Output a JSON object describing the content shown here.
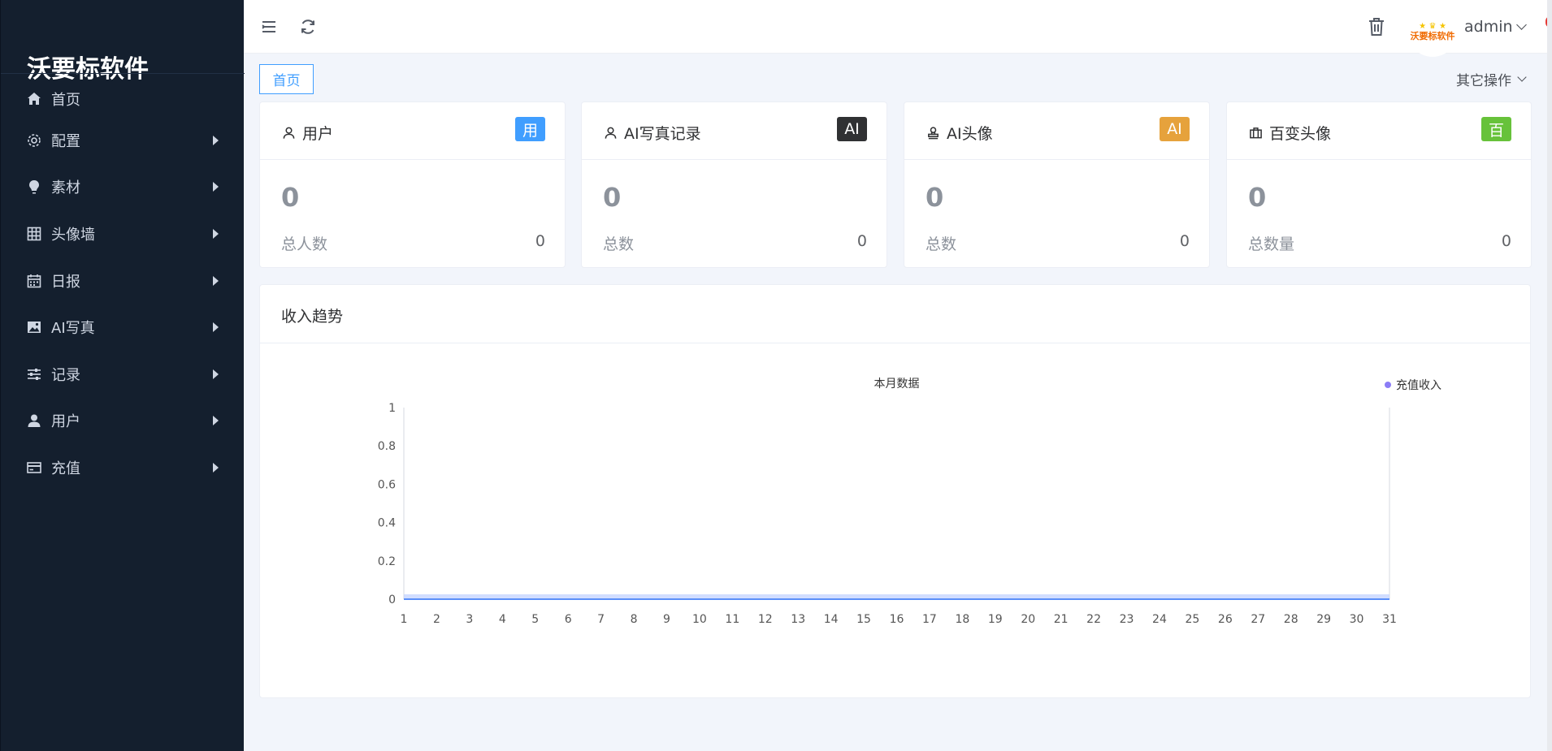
{
  "sidebar": {
    "brand": "沃要标软件",
    "items": [
      {
        "label": "首页",
        "icon": "home-icon",
        "has_children": false
      },
      {
        "label": "配置",
        "icon": "gear-icon",
        "has_children": true
      },
      {
        "label": "素材",
        "icon": "lightbulb-icon",
        "has_children": true
      },
      {
        "label": "头像墙",
        "icon": "grid-icon",
        "has_children": true
      },
      {
        "label": "日报",
        "icon": "calendar-icon",
        "has_children": true
      },
      {
        "label": "AI写真",
        "icon": "picture-icon",
        "has_children": true
      },
      {
        "label": "记录",
        "icon": "sliders-icon",
        "has_children": true
      },
      {
        "label": "用户",
        "icon": "user-icon",
        "has_children": true
      },
      {
        "label": "充值",
        "icon": "card-icon",
        "has_children": true
      }
    ]
  },
  "header": {
    "menu_icon": "hamburger-icon",
    "refresh_icon": "refresh-icon",
    "trash_icon": "trash-icon",
    "avatar_logo": "沃要标软件",
    "username": "admin"
  },
  "tabs": {
    "home": "首页",
    "other_ops": "其它操作"
  },
  "cards": [
    {
      "title": "用户",
      "icon": "user-outline-icon",
      "badge": "用",
      "badge_color": "#409eff",
      "value": "0",
      "sub_label": "总人数",
      "sub_value": "0"
    },
    {
      "title": "AI写真记录",
      "icon": "user-outline-icon",
      "badge": "AI",
      "badge_color": "#303133",
      "value": "0",
      "sub_label": "总数",
      "sub_value": "0"
    },
    {
      "title": "AI头像",
      "icon": "stamp-icon",
      "badge": "AI",
      "badge_color": "#e6a23c",
      "value": "0",
      "sub_label": "总数",
      "sub_value": "0"
    },
    {
      "title": "百变头像",
      "icon": "briefcase-icon",
      "badge": "百",
      "badge_color": "#67c23a",
      "value": "0",
      "sub_label": "总数量",
      "sub_value": "0"
    }
  ],
  "chart_panel": {
    "title": "收入趋势"
  },
  "chart_data": {
    "type": "area",
    "title": "本月数据",
    "x": [
      1,
      2,
      3,
      4,
      5,
      6,
      7,
      8,
      9,
      10,
      11,
      12,
      13,
      14,
      15,
      16,
      17,
      18,
      19,
      20,
      21,
      22,
      23,
      24,
      25,
      26,
      27,
      28,
      29,
      30,
      31
    ],
    "series": [
      {
        "name": "充值收入",
        "values": [
          0,
          0,
          0,
          0,
          0,
          0,
          0,
          0,
          0,
          0,
          0,
          0,
          0,
          0,
          0,
          0,
          0,
          0,
          0,
          0,
          0,
          0,
          0,
          0,
          0,
          0,
          0,
          0,
          0,
          0,
          0
        ],
        "color": "#8b7cf6"
      }
    ],
    "yticks": [
      "0",
      "0.2",
      "0.4",
      "0.6",
      "0.8",
      "1"
    ],
    "ylim": [
      0,
      1
    ],
    "legend": "top-right",
    "line_color": "#5b8ff9"
  }
}
